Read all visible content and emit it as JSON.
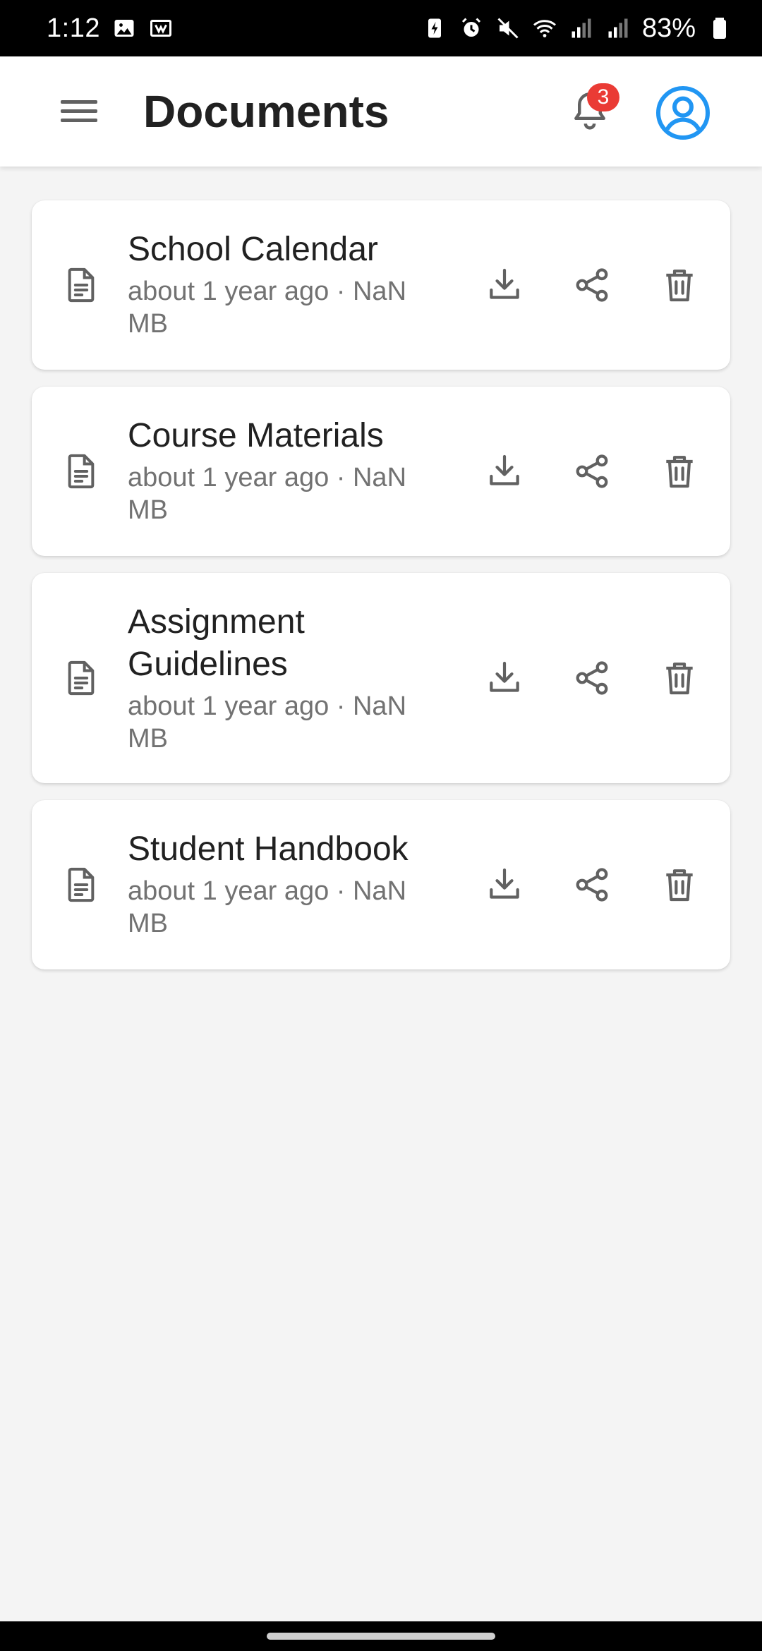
{
  "status_bar": {
    "time": "1:12",
    "battery": "83%"
  },
  "app_bar": {
    "title": "Documents",
    "notification_count": "3"
  },
  "colors": {
    "accent": "#2196f3",
    "badge": "#ea3b35",
    "icon": "#616161",
    "background": "#f4f4f4"
  },
  "documents": [
    {
      "title": "School Calendar",
      "meta": "about 1 year ago · NaN MB"
    },
    {
      "title": "Course Materials",
      "meta": "about 1 year ago · NaN MB"
    },
    {
      "title": "Assignment Guidelines",
      "meta": "about 1 year ago · NaN MB"
    },
    {
      "title": "Student Handbook",
      "meta": "about 1 year ago · NaN MB"
    }
  ],
  "icons": {
    "menu": "hamburger-icon",
    "notifications": "bell-icon",
    "profile": "account-circle-icon",
    "document": "document-icon",
    "download": "download-icon",
    "share": "share-icon",
    "delete": "trash-icon"
  }
}
